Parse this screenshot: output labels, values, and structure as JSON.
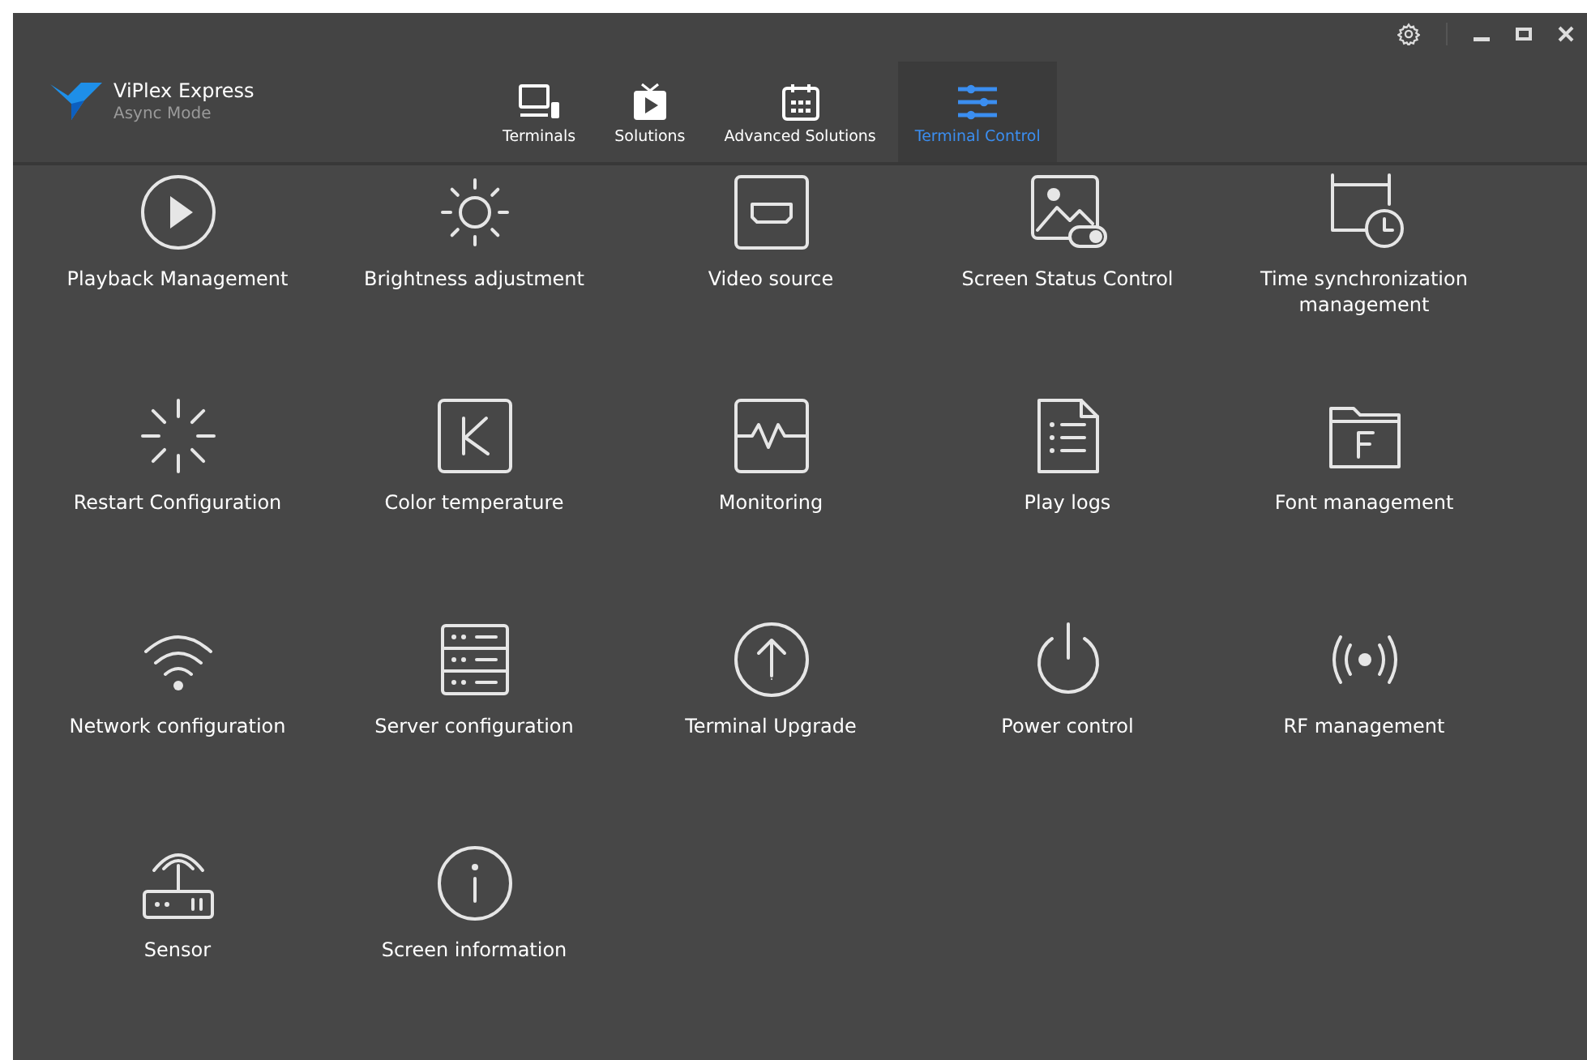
{
  "app": {
    "name": "ViPlex Express",
    "mode": "Async Mode"
  },
  "tabs": [
    {
      "label": "Terminals",
      "selected": false
    },
    {
      "label": "Solutions",
      "selected": false
    },
    {
      "label": "Advanced Solutions",
      "selected": false
    },
    {
      "label": "Terminal Control",
      "selected": true
    }
  ],
  "functions": [
    {
      "label": "Playback Management"
    },
    {
      "label": "Brightness adjustment"
    },
    {
      "label": "Video source"
    },
    {
      "label": "Screen Status Control"
    },
    {
      "label": "Time synchronization management"
    },
    {
      "label": "Restart Configuration"
    },
    {
      "label": "Color temperature"
    },
    {
      "label": "Monitoring"
    },
    {
      "label": "Play logs"
    },
    {
      "label": "Font management"
    },
    {
      "label": "Network configuration"
    },
    {
      "label": "Server configuration"
    },
    {
      "label": "Terminal Upgrade"
    },
    {
      "label": "Power control"
    },
    {
      "label": "RF management"
    },
    {
      "label": "Sensor"
    },
    {
      "label": "Screen information"
    }
  ]
}
